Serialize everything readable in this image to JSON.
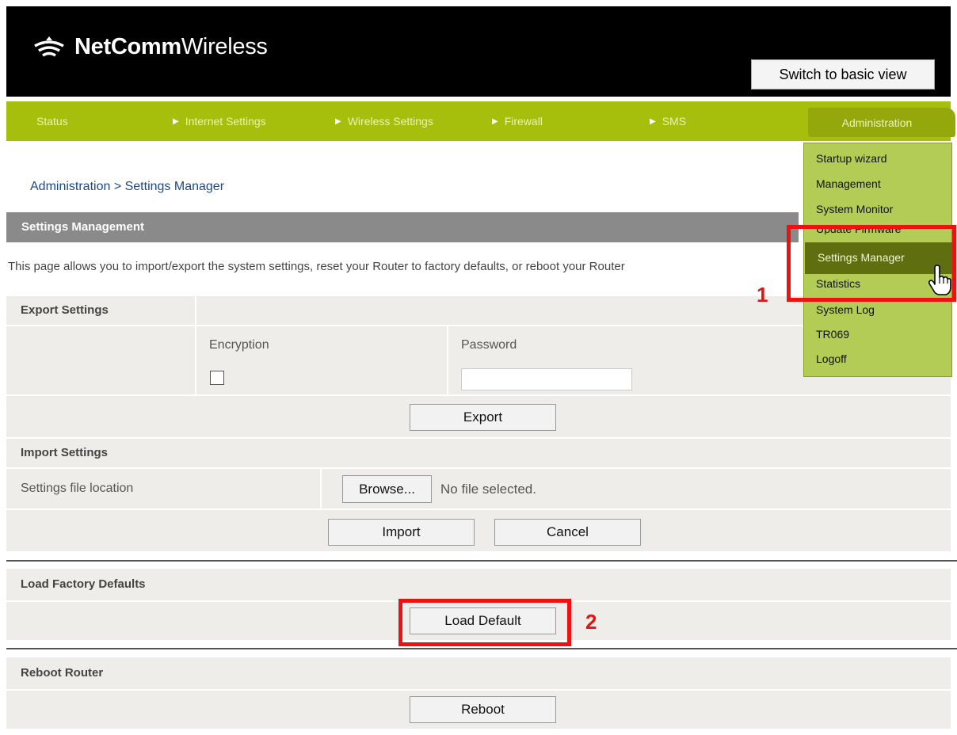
{
  "header": {
    "brand_bold": "NetComm",
    "brand_light": "Wireless",
    "switch_label": "Switch to basic view"
  },
  "nav": {
    "items": [
      "Status",
      "Internet Settings",
      "Wireless Settings",
      "Firewall",
      "SMS"
    ],
    "active": "Administration"
  },
  "dropdown": {
    "items": [
      "Startup wizard",
      "Management",
      "System Monitor",
      "Update Firmware",
      "Settings Manager",
      "Statistics",
      "System Log",
      "TR069",
      "Logoff"
    ]
  },
  "breadcrumb": "Administration > Settings Manager",
  "section_title": "Settings Management",
  "description": "This page allows you to import/export the system settings, reset your Router to factory defaults, or reboot your Router",
  "export": {
    "title": "Export Settings",
    "encryption_label": "Encryption",
    "password_label": "Password",
    "password_value": "",
    "button": "Export"
  },
  "import": {
    "title": "Import Settings",
    "file_label": "Settings file location",
    "browse_button": "Browse...",
    "file_status": "No file selected.",
    "import_button": "Import",
    "cancel_button": "Cancel"
  },
  "factory": {
    "title": "Load Factory Defaults",
    "button": "Load Default"
  },
  "reboot": {
    "title": "Reboot Router",
    "button": "Reboot"
  },
  "annotations": {
    "step1": "1",
    "step2": "2",
    "color": "#ee1111"
  },
  "colors": {
    "nav_green": "#a6be0c",
    "menu_green": "#b3cc55",
    "active_menu": "#5f6f10"
  }
}
